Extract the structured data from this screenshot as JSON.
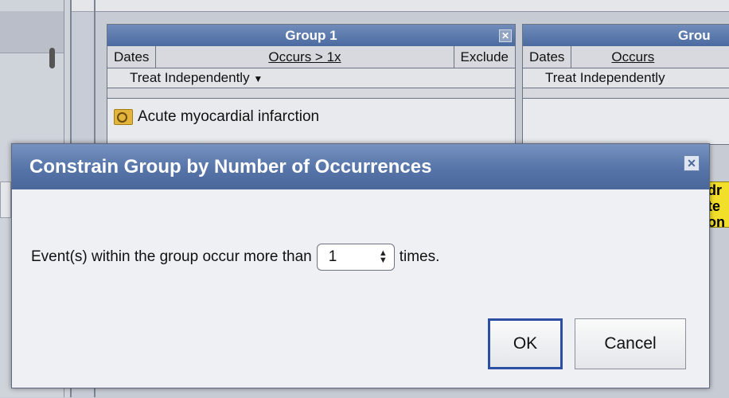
{
  "groups": [
    {
      "title": "Group 1",
      "close_icon": "close-icon",
      "dates_label": "Dates",
      "occurs_label": "Occurs > 1x",
      "exclude_label": "Exclude",
      "treat_label": "Treat Independently",
      "concepts": [
        "Acute myocardial infarction"
      ]
    },
    {
      "title": "Grou",
      "dates_label": "Dates",
      "occurs_label": "Occurs",
      "treat_label": "Treat Independently"
    }
  ],
  "side_note": {
    "lines": [
      "dr",
      "te",
      "on"
    ],
    "color": "#f2df2a"
  },
  "dialog": {
    "title": "Constrain Group by Number of Occurrences",
    "close_icon": "close-icon",
    "text_before": "Event(s) within the group occur more than",
    "stepper_value": "1",
    "text_after": "times.",
    "ok_label": "OK",
    "cancel_label": "Cancel",
    "header_color": "#5674a8",
    "ok_border_color": "#2c4fa3"
  }
}
